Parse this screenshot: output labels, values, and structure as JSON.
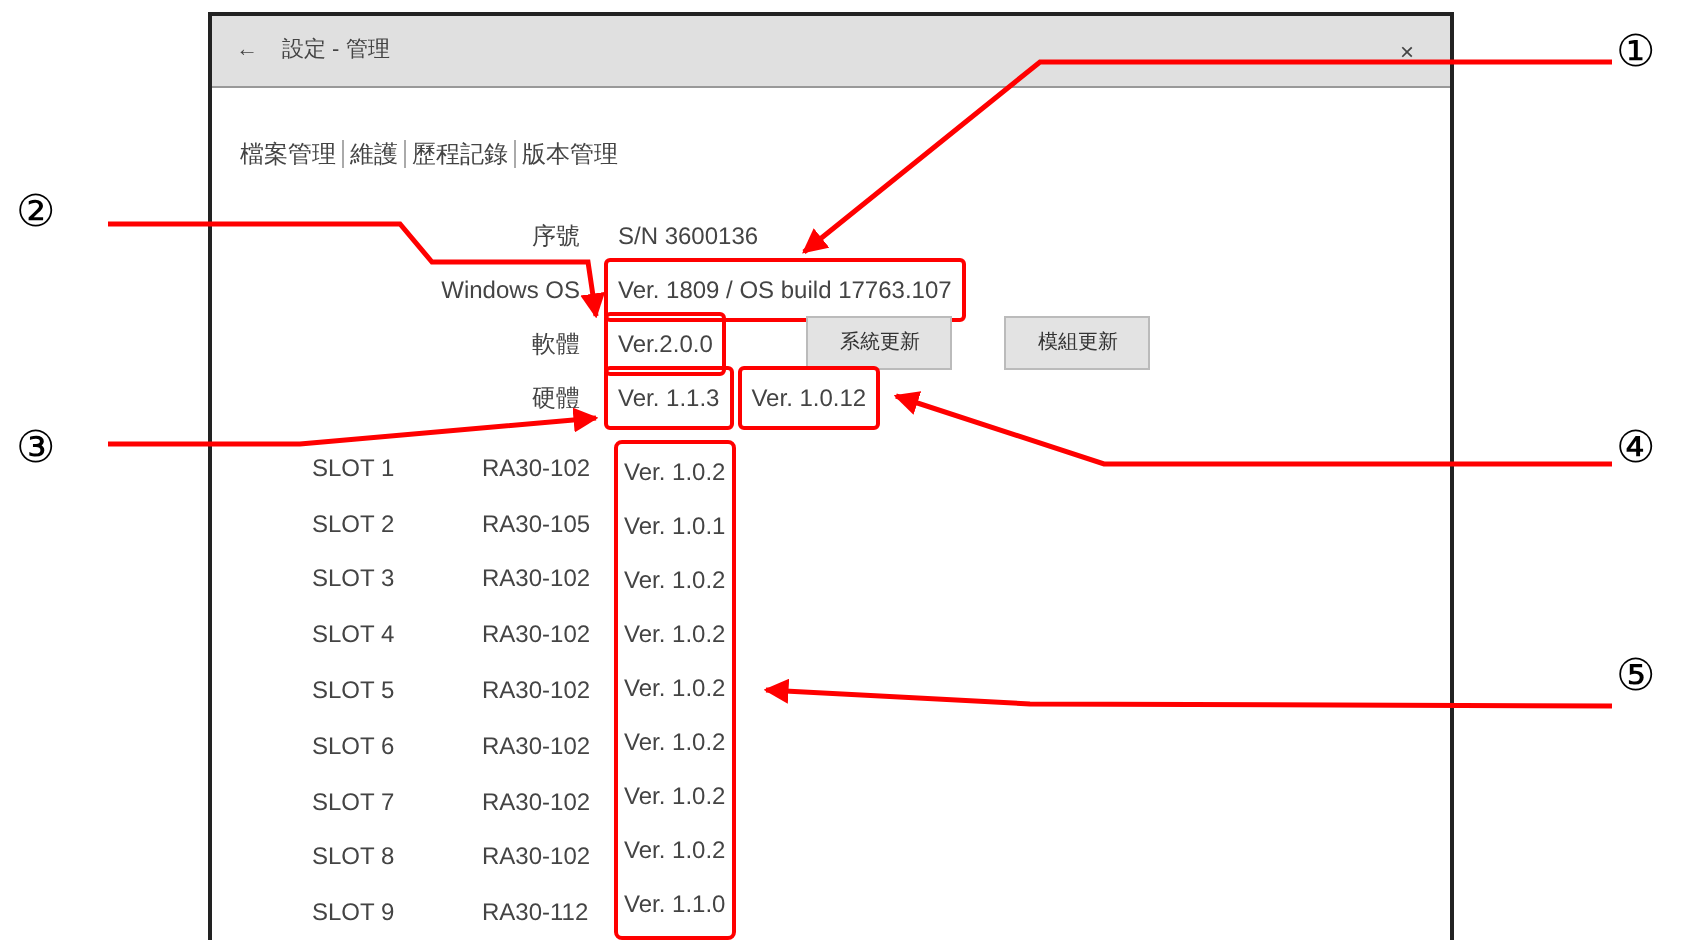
{
  "window": {
    "title": "設定 - 管理",
    "close": "×",
    "back": "←"
  },
  "nav_links": [
    "檔案管理",
    "維護",
    "歷程記錄",
    "版本管理"
  ],
  "info_rows": [
    {
      "label": "序號",
      "values": [
        {
          "text": "S/N 3600136",
          "highlighted": false
        }
      ]
    },
    {
      "label": "Windows OS",
      "values": [
        {
          "text": "Ver. 1809 / OS build 17763.107",
          "highlighted": true
        }
      ]
    },
    {
      "label": "軟體",
      "values": [
        {
          "text": "Ver.2.0.0",
          "highlighted": true
        }
      ],
      "buttons": [
        "系統更新",
        "模組更新"
      ]
    },
    {
      "label": "硬體",
      "values": [
        {
          "text": "Ver. 1.1.3",
          "highlighted": true
        },
        {
          "text": "Ver. 1.0.12",
          "highlighted": true
        }
      ]
    }
  ],
  "slots": {
    "highlighted": true,
    "rows": [
      {
        "slot": "SLOT 1",
        "model": "RA30-102",
        "version": "Ver. 1.0.2"
      },
      {
        "slot": "SLOT 2",
        "model": "RA30-105",
        "version": "Ver. 1.0.1"
      },
      {
        "slot": "SLOT 3",
        "model": "RA30-102",
        "version": "Ver. 1.0.2"
      },
      {
        "slot": "SLOT 4",
        "model": "RA30-102",
        "version": "Ver. 1.0.2"
      },
      {
        "slot": "SLOT 5",
        "model": "RA30-102",
        "version": "Ver. 1.0.2"
      },
      {
        "slot": "SLOT 6",
        "model": "RA30-102",
        "version": "Ver. 1.0.2"
      },
      {
        "slot": "SLOT 7",
        "model": "RA30-102",
        "version": "Ver. 1.0.2"
      },
      {
        "slot": "SLOT 8",
        "model": "RA30-102",
        "version": "Ver. 1.0.2"
      },
      {
        "slot": "SLOT 9",
        "model": "RA30-112",
        "version": "Ver. 1.1.0"
      }
    ]
  },
  "callouts": [
    "①",
    "②",
    "③",
    "④",
    "⑤"
  ]
}
